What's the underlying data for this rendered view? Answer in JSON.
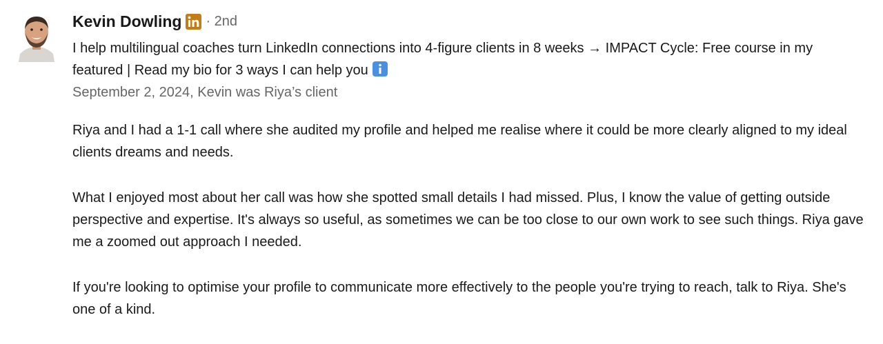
{
  "recommendation": {
    "author": {
      "name": "Kevin Dowling",
      "badge_icon": "linkedin-premium-icon",
      "degree": "· 2nd",
      "headline": "I help multilingual coaches turn LinkedIn connections into 4-figure clients in 8 weeks → IMPACT Cycle: Free course in my featured | Read my bio for 3 ways I can help you",
      "headline_icon": "information-emoji-icon"
    },
    "meta": "September 2, 2024, Kevin was Riya’s client",
    "paragraphs": [
      "Riya and I had a 1-1 call where she audited my profile and helped me realise where it could be more clearly aligned to my ideal clients dreams and needs.",
      "What I enjoyed most about her call was how she spotted small details I had missed. Plus, I know the value of getting outside perspective and expertise. It's always so useful, as sometimes we can be too close to our own work to see such things. Riya gave me a zoomed out approach I needed.",
      "If you're looking to optimise your profile to communicate more effectively to the people you're trying to reach, talk to Riya. She's one of a kind."
    ]
  },
  "colors": {
    "linkedin_badge": "#C37D16",
    "secondary_text": "#666666",
    "info_icon": "#4A90E2"
  }
}
